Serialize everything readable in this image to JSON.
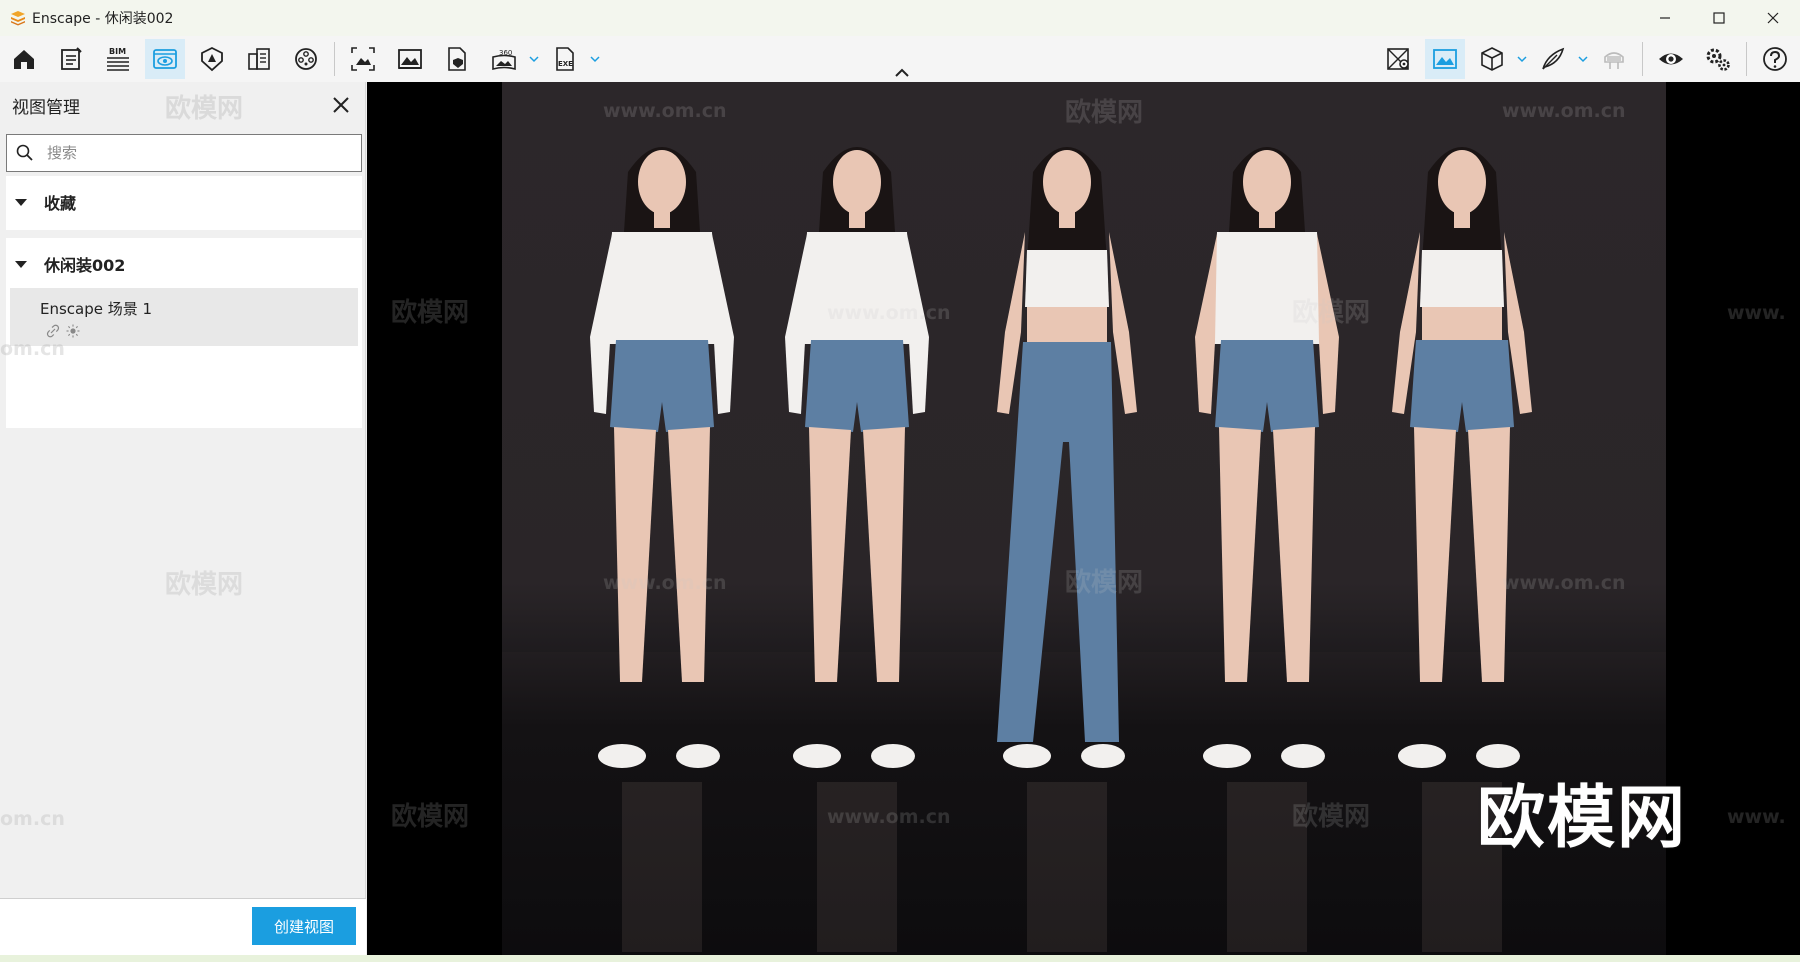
{
  "window": {
    "title": "Enscape - 休闲装002",
    "controls": [
      "minimize",
      "maximize",
      "close"
    ]
  },
  "toolbar": {
    "left_tools": [
      {
        "name": "home-button",
        "icon": "home-icon"
      },
      {
        "name": "asset-library-button",
        "icon": "notebook-icon"
      },
      {
        "name": "bim-button",
        "icon": "bim-icon",
        "text": "BIM"
      },
      {
        "name": "view-management-button",
        "icon": "eye-window-icon",
        "active": true
      },
      {
        "name": "atmosphere-button",
        "icon": "shield-eye-icon"
      },
      {
        "name": "building-button",
        "icon": "building-icon"
      },
      {
        "name": "video-editor-button",
        "icon": "film-reel-icon"
      },
      {
        "name": "screenshot-button",
        "icon": "frame-image-icon"
      },
      {
        "name": "image-button",
        "icon": "image-icon"
      },
      {
        "name": "web-standalone-button",
        "icon": "file-shield-icon"
      },
      {
        "name": "panorama-button",
        "icon": "panorama-360-icon",
        "text": "360"
      },
      {
        "name": "exe-export-button",
        "icon": "file-exe-icon",
        "text": "EXE"
      }
    ],
    "right_tools": [
      {
        "name": "map-button",
        "icon": "map-pin-icon"
      },
      {
        "name": "material-button",
        "icon": "picture-frame-icon",
        "active": true
      },
      {
        "name": "cube-button",
        "icon": "cube-icon"
      },
      {
        "name": "brush-button",
        "icon": "feather-icon"
      },
      {
        "name": "vr-button",
        "icon": "vr-headset-icon"
      },
      {
        "name": "visual-settings-button",
        "icon": "eye-icon"
      },
      {
        "name": "settings-button",
        "icon": "gears-icon"
      },
      {
        "name": "help-button",
        "icon": "help-icon"
      }
    ]
  },
  "panel": {
    "title": "视图管理",
    "search_placeholder": "搜索",
    "favorites_label": "收藏",
    "project_label": "休闲装002",
    "view_item_label": "Enscape 场景 1",
    "create_button_label": "创建视图"
  },
  "viewport": {
    "watermark_text": "欧模网",
    "watermark_url": "www.om.cn",
    "watermark_url_fragment": "om.cn",
    "watermark_url_edge": "www.",
    "brand_watermark": "欧模网"
  },
  "colors": {
    "accent": "#1b9ee0",
    "active_tool_bg": "#d9ecf7",
    "titlebar_bg": "#f3f6ee"
  }
}
